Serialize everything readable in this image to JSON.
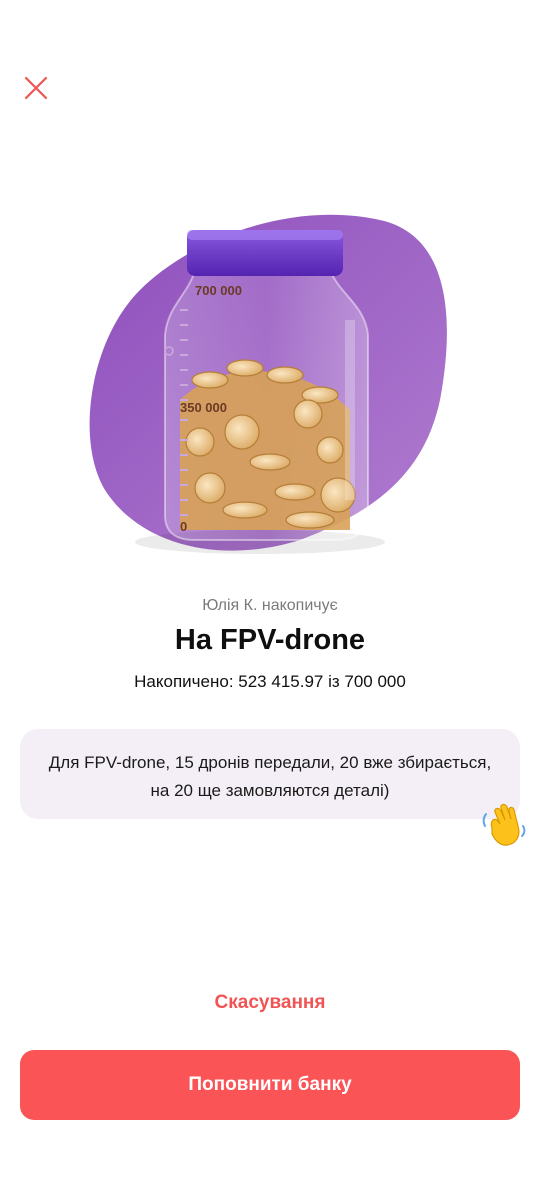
{
  "jar": {
    "icons": {
      "close": "close-icon",
      "wave": "waving-hand-icon"
    },
    "scale_labels": {
      "top": "700 000",
      "middle": "350 000",
      "bottom": "0"
    },
    "fill_fraction": 0.75,
    "owner_text": "Юлія К. накопичує",
    "title": "На FPV-drone",
    "progress_text": "Накопичено: 523 415.97 із 700 000",
    "comment": "Для FPV-drone, 15 дронів передали, 20 вже збирається, на 20 ще замовляются деталі)"
  },
  "actions": {
    "cancel_label": "Скасування",
    "topup_label": "Поповнити банку"
  },
  "colors": {
    "accent": "#fa5456",
    "cancel_text": "#f05454",
    "blob": "#9b5fc0",
    "lid": "#6a32c2",
    "comment_bg": "#f4eff6"
  }
}
